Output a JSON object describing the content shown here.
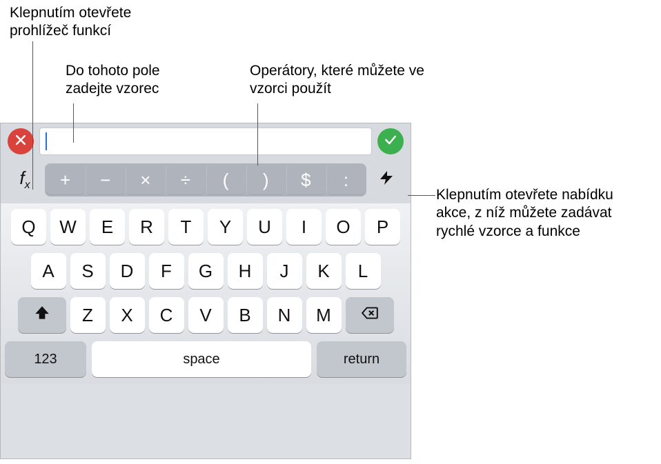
{
  "callouts": {
    "open_function_browser": "Klepnutím otevřete prohlížeč funkcí",
    "enter_formula": "Do tohoto pole zadejte vzorec",
    "operators_hint": "Operátory, které můžete ve vzorci použít",
    "quick_action_menu": "Klepnutím otevřete nabídku akce, z níž můžete zadávat rychlé vzorce a funkce"
  },
  "formula_bar": {
    "value": "",
    "cancel_label": "Cancel",
    "accept_label": "Accept"
  },
  "fx_label": "fx",
  "operators": [
    "+",
    "−",
    "×",
    "÷",
    "(",
    ")",
    "$",
    ":"
  ],
  "keyboard": {
    "row1": [
      "Q",
      "W",
      "E",
      "R",
      "T",
      "Y",
      "U",
      "I",
      "O",
      "P"
    ],
    "row2": [
      "A",
      "S",
      "D",
      "F",
      "G",
      "H",
      "J",
      "K",
      "L"
    ],
    "row3": [
      "Z",
      "X",
      "C",
      "V",
      "B",
      "N",
      "M"
    ],
    "switch_label": "123",
    "space_label": "space",
    "return_label": "return"
  }
}
